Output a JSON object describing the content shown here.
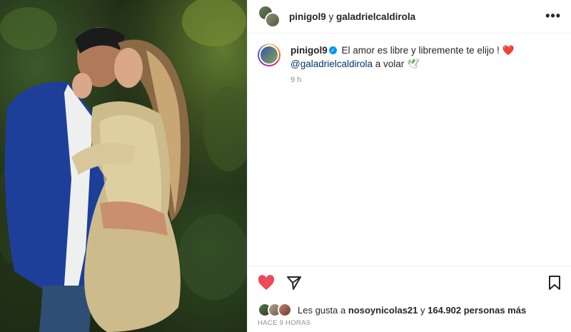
{
  "post": {
    "header": {
      "user1": "pinigol9",
      "separator": "y",
      "user2": "galadrielcaldirola",
      "more_icon": "more-horizontal-icon"
    },
    "caption": {
      "username": "pinigol9",
      "verified_icon": "verified-badge-icon",
      "text": "El amor es libre y libremente te elijo !",
      "emoji_heart": "❤️",
      "mention": "@galadrielcaldirola",
      "text2": "a volar",
      "emoji_dove": "🕊",
      "time": "9 h"
    },
    "actions": {
      "like_icon": "heart-filled-icon",
      "share_icon": "send-icon",
      "save_icon": "bookmark-icon",
      "like_color": "#ed4956"
    },
    "likes": {
      "prefix": "Les gusta a",
      "first_user": "nosoynicolas21",
      "joiner": "y",
      "count": "164.902 personas más"
    },
    "timestamp": "HACE 9 HORAS"
  }
}
